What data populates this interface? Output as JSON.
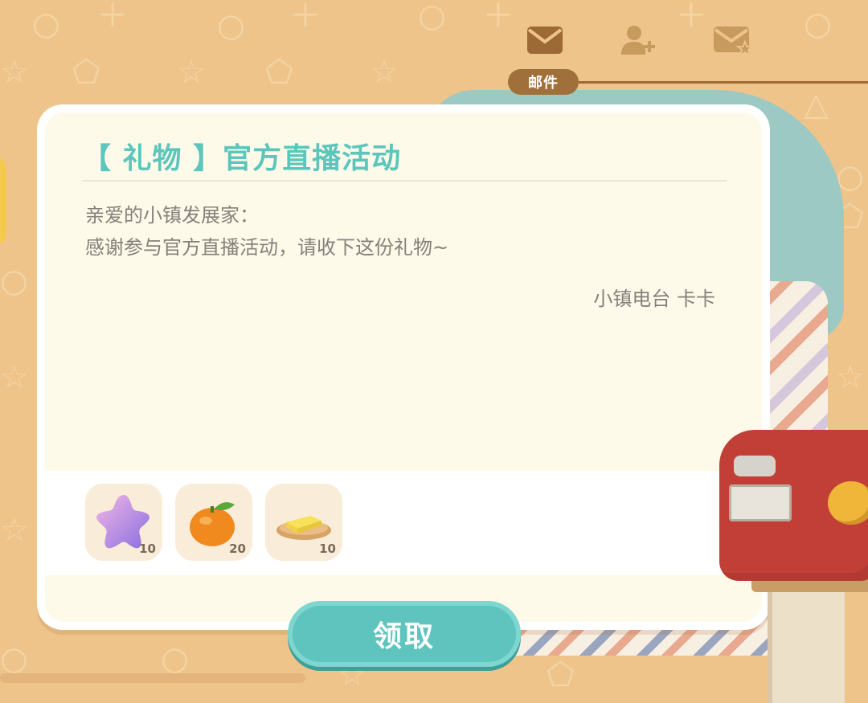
{
  "tabs": {
    "active_label": "邮件",
    "items": [
      {
        "icon": "mail-icon",
        "active": true
      },
      {
        "icon": "add-friend-icon",
        "active": false
      },
      {
        "icon": "starred-mail-icon",
        "active": false
      }
    ]
  },
  "mail": {
    "title": "【 礼物 】官方直播活动",
    "greeting": "亲爱的小镇发展家：",
    "body": "感谢参与官方直播活动，请收下这份礼物~",
    "signature": "小镇电台 卡卡"
  },
  "rewards": [
    {
      "icon": "purple-star-icon",
      "count": "10"
    },
    {
      "icon": "orange-fruit-icon",
      "count": "20"
    },
    {
      "icon": "butter-plate-icon",
      "count": "10"
    }
  ],
  "claim_button": {
    "label": "领取"
  },
  "colors": {
    "background": "#eec48a",
    "title": "#5cc6bd",
    "button": "#5fc4bd",
    "tab_label": "#a0703b",
    "mailbox": "#c23f37"
  }
}
